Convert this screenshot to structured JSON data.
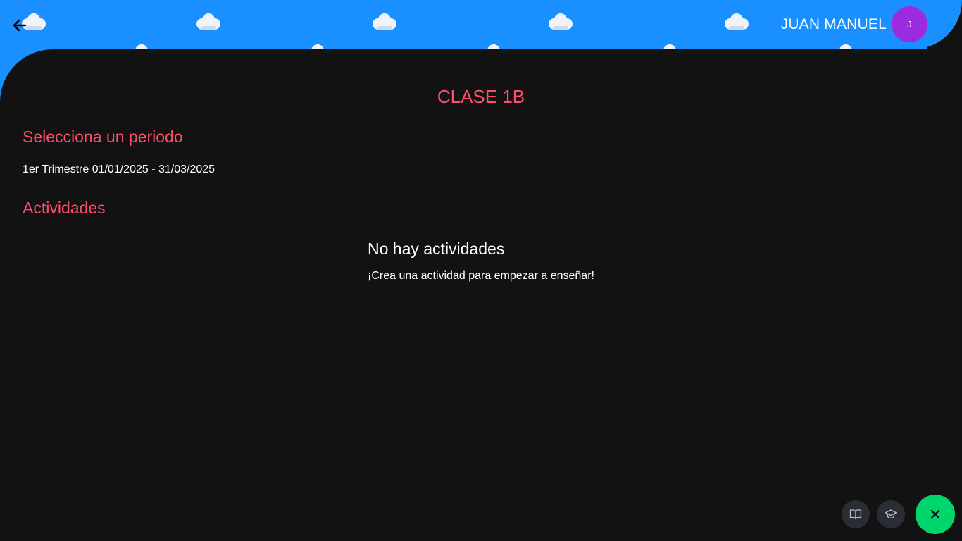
{
  "header": {
    "user_name": "JUAN MANUEL",
    "avatar_initial": "J",
    "background_color": "#1a8fff",
    "avatar_color": "#9b2bdc"
  },
  "page": {
    "class_title": "CLASE 1B",
    "period_heading": "Selecciona un periodo",
    "period_option": "1er Trimestre 01/01/2025 - 31/03/2025",
    "activities_heading": "Actividades",
    "empty_title": "No hay actividades",
    "empty_subtitle": "¡Crea una actividad para empezar a enseñar!",
    "accent_color": "#ff4d6a",
    "background_color": "#121212"
  },
  "fab": {
    "main_color": "#00d66b",
    "icons": [
      "book-open-icon",
      "graduation-cap-icon",
      "close-icon"
    ]
  }
}
